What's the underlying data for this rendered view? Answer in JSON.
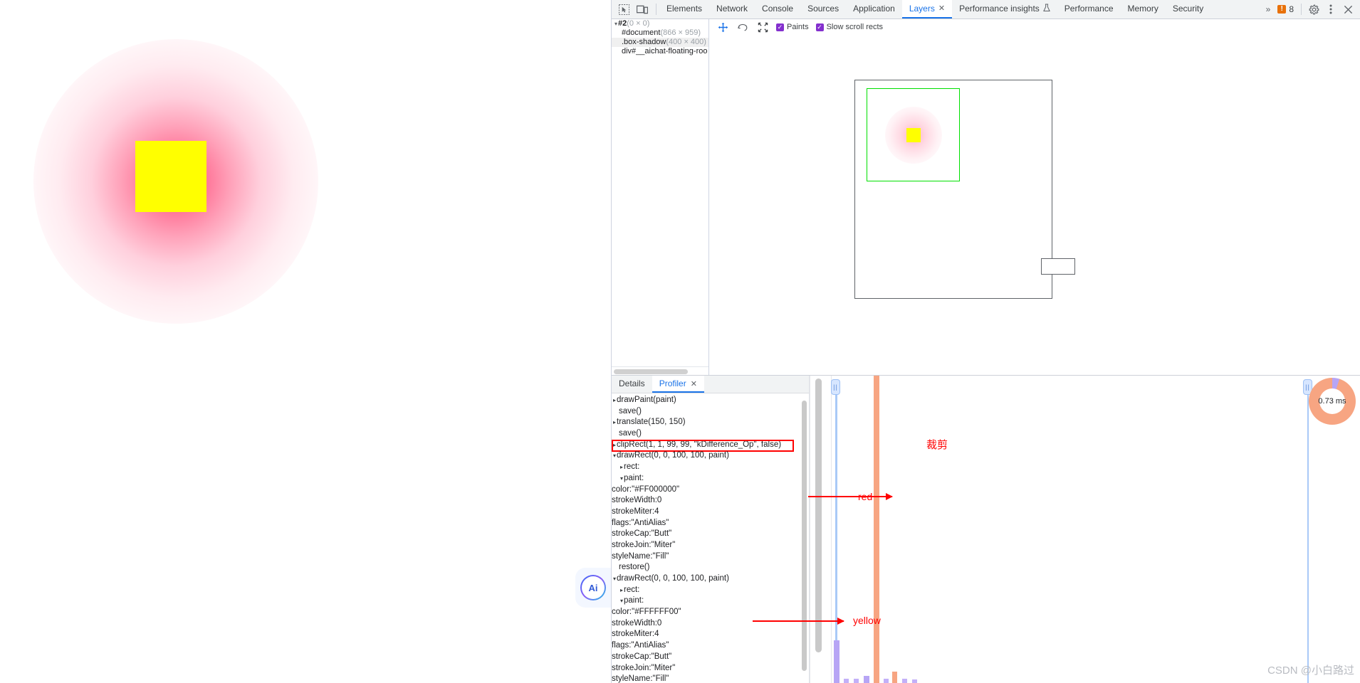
{
  "page": {
    "yellow_square_color": "#FFFF00",
    "glow_color": "#FF0040",
    "ai_button_label": "Ai"
  },
  "devtools": {
    "inspect_icon": "inspect-element-icon",
    "device_icon": "device-toolbar-icon",
    "tabs": [
      {
        "label": "Elements",
        "active": false,
        "closable": false
      },
      {
        "label": "Network",
        "active": false,
        "closable": false
      },
      {
        "label": "Console",
        "active": false,
        "closable": false
      },
      {
        "label": "Sources",
        "active": false,
        "closable": false
      },
      {
        "label": "Application",
        "active": false,
        "closable": false
      },
      {
        "label": "Layers",
        "active": true,
        "closable": true
      },
      {
        "label": "Performance insights",
        "active": false,
        "closable": false,
        "flask": true
      },
      {
        "label": "Performance",
        "active": false,
        "closable": false
      },
      {
        "label": "Memory",
        "active": false,
        "closable": false
      },
      {
        "label": "Security",
        "active": false,
        "closable": false
      }
    ],
    "overflow_chevron": "»",
    "warning_count": "8",
    "settings_icon": "gear-icon",
    "more_icon": "kebab-menu-icon",
    "close_icon": "close-icon"
  },
  "layer_tree": {
    "items": [
      {
        "name": "#2",
        "size": "(0 × 0)",
        "triangle": "▾",
        "indent": 0,
        "selected": false
      },
      {
        "name": "#document",
        "size": "(866 × 959)",
        "triangle": "",
        "indent": 1,
        "selected": false
      },
      {
        "name": ".box-shadow",
        "size": "(400 × 400)",
        "triangle": "",
        "indent": 1,
        "selected": true
      },
      {
        "name": "div#__aichat-floating-roo",
        "size": "",
        "triangle": "",
        "indent": 1,
        "selected": false
      }
    ]
  },
  "layers_toolbar": {
    "pan_icon": "pan-move-icon",
    "rotate_icon": "rotate-icon",
    "reset_icon": "reset-transform-icon",
    "paints_label": "Paints",
    "paints_checked": true,
    "slow_scroll_label": "Slow scroll rects",
    "slow_scroll_checked": true
  },
  "drawer": {
    "tabs": [
      {
        "label": "Details",
        "active": false,
        "closable": false
      },
      {
        "label": "Profiler",
        "active": true,
        "closable": true
      }
    ],
    "commands": [
      {
        "text": "drawPaint(paint)",
        "triangle": "▸",
        "level": 0,
        "highlight": false
      },
      {
        "text": "save()",
        "triangle": "",
        "level": 0,
        "highlight": false
      },
      {
        "text": "translate(150, 150)",
        "triangle": "▸",
        "level": 0,
        "highlight": false
      },
      {
        "text": "save()",
        "triangle": "",
        "level": 0,
        "highlight": false
      },
      {
        "text": "clipRect(1, 1, 99, 99, \"kDifference_Op\", false)",
        "triangle": "▸",
        "level": 0,
        "highlight": true
      },
      {
        "text": "drawRect(0, 0, 100, 100, paint)",
        "triangle": "▾",
        "level": 0,
        "highlight": false
      },
      {
        "text": "rect:",
        "triangle": "▸",
        "level": 1,
        "highlight": false
      },
      {
        "text": "paint:",
        "triangle": "▾",
        "level": 1,
        "highlight": false
      },
      {
        "text": "color:\"#FF000000\"",
        "triangle": "",
        "level": 2,
        "highlight": false
      },
      {
        "text": "strokeWidth:0",
        "triangle": "",
        "level": 2,
        "highlight": false
      },
      {
        "text": "strokeMiter:4",
        "triangle": "",
        "level": 2,
        "highlight": false
      },
      {
        "text": "flags:\"AntiAlias\"",
        "triangle": "",
        "level": 2,
        "highlight": false
      },
      {
        "text": "strokeCap:\"Butt\"",
        "triangle": "",
        "level": 2,
        "highlight": false
      },
      {
        "text": "strokeJoin:\"Miter\"",
        "triangle": "",
        "level": 2,
        "highlight": false
      },
      {
        "text": "styleName:\"Fill\"",
        "triangle": "",
        "level": 2,
        "highlight": false
      },
      {
        "text": "restore()",
        "triangle": "",
        "level": 0,
        "highlight": false
      },
      {
        "text": "drawRect(0, 0, 100, 100, paint)",
        "triangle": "▾",
        "level": 0,
        "highlight": false
      },
      {
        "text": "rect:",
        "triangle": "▸",
        "level": 1,
        "highlight": false
      },
      {
        "text": "paint:",
        "triangle": "▾",
        "level": 1,
        "highlight": false
      },
      {
        "text": "color:\"#FFFFFF00\"",
        "triangle": "",
        "level": 2,
        "highlight": false
      },
      {
        "text": "strokeWidth:0",
        "triangle": "",
        "level": 2,
        "highlight": false
      },
      {
        "text": "strokeMiter:4",
        "triangle": "",
        "level": 2,
        "highlight": false
      },
      {
        "text": "flags:\"AntiAlias\"",
        "triangle": "",
        "level": 2,
        "highlight": false
      },
      {
        "text": "strokeCap:\"Butt\"",
        "triangle": "",
        "level": 2,
        "highlight": false
      },
      {
        "text": "strokeJoin:\"Miter\"",
        "triangle": "",
        "level": 2,
        "highlight": false
      },
      {
        "text": "styleName:\"Fill\"",
        "triangle": "",
        "level": 2,
        "highlight": false
      }
    ],
    "total_time": "0.73 ms"
  },
  "annotations": {
    "clip_label": "裁剪",
    "red_label": "red",
    "yellow_label": "yellow",
    "highlight_color": "#FF0000"
  },
  "watermark": "CSDN @小白路过"
}
